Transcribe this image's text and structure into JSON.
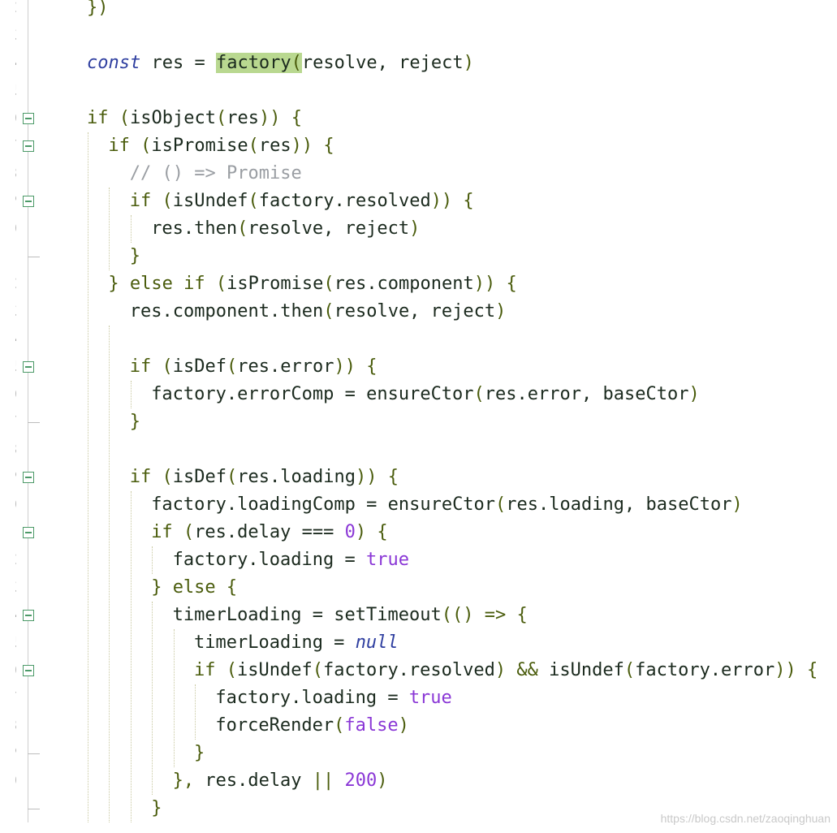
{
  "editor": {
    "line_numbers": [
      "2",
      "3",
      "4",
      "5",
      "6",
      "7",
      "8",
      "9",
      "0",
      "1",
      "2",
      "3",
      "4",
      "5",
      "6",
      "7",
      "8",
      "9",
      "0",
      "1",
      "2",
      "3",
      "4",
      "5",
      "6",
      "7",
      "8",
      "9",
      "0",
      "1"
    ],
    "lines": [
      {
        "tokens": [
          {
            "t": "})",
            "c": "punc"
          }
        ]
      },
      {
        "tokens": []
      },
      {
        "tokens": [
          {
            "t": "const",
            "c": "kw-const"
          },
          {
            "t": " res = ",
            "c": "plain"
          },
          {
            "t": "factory",
            "c": "fn hl"
          },
          {
            "t": "(",
            "c": "punc hl"
          },
          {
            "t": "resolve, reject",
            "c": "plain"
          },
          {
            "t": ")",
            "c": "punc"
          }
        ]
      },
      {
        "tokens": []
      },
      {
        "tokens": [
          {
            "t": "if",
            "c": "kw"
          },
          {
            "t": " (",
            "c": "punc"
          },
          {
            "t": "isObject",
            "c": "fn"
          },
          {
            "t": "(",
            "c": "punc"
          },
          {
            "t": "res",
            "c": "plain"
          },
          {
            "t": ")) {",
            "c": "punc"
          }
        ]
      },
      {
        "tokens": [
          {
            "t": "if",
            "c": "kw"
          },
          {
            "t": " (",
            "c": "punc"
          },
          {
            "t": "isPromise",
            "c": "fn"
          },
          {
            "t": "(",
            "c": "punc"
          },
          {
            "t": "res",
            "c": "plain"
          },
          {
            "t": ")) {",
            "c": "punc"
          }
        ]
      },
      {
        "tokens": [
          {
            "t": "// () => Promise",
            "c": "comment"
          }
        ]
      },
      {
        "tokens": [
          {
            "t": "if",
            "c": "kw"
          },
          {
            "t": " (",
            "c": "punc"
          },
          {
            "t": "isUndef",
            "c": "fn"
          },
          {
            "t": "(",
            "c": "punc"
          },
          {
            "t": "factory.resolved",
            "c": "plain"
          },
          {
            "t": ")) {",
            "c": "punc"
          }
        ]
      },
      {
        "tokens": [
          {
            "t": "res.then",
            "c": "plain"
          },
          {
            "t": "(",
            "c": "punc"
          },
          {
            "t": "resolve, reject",
            "c": "plain"
          },
          {
            "t": ")",
            "c": "punc"
          }
        ]
      },
      {
        "tokens": [
          {
            "t": "}",
            "c": "punc"
          }
        ]
      },
      {
        "tokens": [
          {
            "t": "} ",
            "c": "punc"
          },
          {
            "t": "else if",
            "c": "kw"
          },
          {
            "t": " (",
            "c": "punc"
          },
          {
            "t": "isPromise",
            "c": "fn"
          },
          {
            "t": "(",
            "c": "punc"
          },
          {
            "t": "res.component",
            "c": "plain"
          },
          {
            "t": ")) {",
            "c": "punc"
          }
        ]
      },
      {
        "tokens": [
          {
            "t": "res.component.then",
            "c": "plain"
          },
          {
            "t": "(",
            "c": "punc"
          },
          {
            "t": "resolve, reject",
            "c": "plain"
          },
          {
            "t": ")",
            "c": "punc"
          }
        ]
      },
      {
        "tokens": []
      },
      {
        "tokens": [
          {
            "t": "if",
            "c": "kw"
          },
          {
            "t": " (",
            "c": "punc"
          },
          {
            "t": "isDef",
            "c": "fn"
          },
          {
            "t": "(",
            "c": "punc"
          },
          {
            "t": "res.error",
            "c": "plain"
          },
          {
            "t": ")) {",
            "c": "punc"
          }
        ]
      },
      {
        "tokens": [
          {
            "t": "factory.errorComp = ",
            "c": "plain"
          },
          {
            "t": "ensureCtor",
            "c": "fn"
          },
          {
            "t": "(",
            "c": "punc"
          },
          {
            "t": "res.error, baseCtor",
            "c": "plain"
          },
          {
            "t": ")",
            "c": "punc"
          }
        ]
      },
      {
        "tokens": [
          {
            "t": "}",
            "c": "punc"
          }
        ]
      },
      {
        "tokens": []
      },
      {
        "tokens": [
          {
            "t": "if",
            "c": "kw"
          },
          {
            "t": " (",
            "c": "punc"
          },
          {
            "t": "isDef",
            "c": "fn"
          },
          {
            "t": "(",
            "c": "punc"
          },
          {
            "t": "res.loading",
            "c": "plain"
          },
          {
            "t": ")) {",
            "c": "punc"
          }
        ]
      },
      {
        "tokens": [
          {
            "t": "factory.loadingComp = ",
            "c": "plain"
          },
          {
            "t": "ensureCtor",
            "c": "fn"
          },
          {
            "t": "(",
            "c": "punc"
          },
          {
            "t": "res.loading, baseCtor",
            "c": "plain"
          },
          {
            "t": ")",
            "c": "punc"
          }
        ]
      },
      {
        "tokens": [
          {
            "t": "if",
            "c": "kw"
          },
          {
            "t": " (",
            "c": "punc"
          },
          {
            "t": "res.delay === ",
            "c": "plain"
          },
          {
            "t": "0",
            "c": "num"
          },
          {
            "t": ") {",
            "c": "punc"
          }
        ]
      },
      {
        "tokens": [
          {
            "t": "factory.loading = ",
            "c": "plain"
          },
          {
            "t": "true",
            "c": "bool"
          }
        ]
      },
      {
        "tokens": [
          {
            "t": "} ",
            "c": "punc"
          },
          {
            "t": "else",
            "c": "kw"
          },
          {
            "t": " {",
            "c": "punc"
          }
        ]
      },
      {
        "tokens": [
          {
            "t": "timerLoading = ",
            "c": "plain"
          },
          {
            "t": "setTimeout",
            "c": "fn"
          },
          {
            "t": "(() => {",
            "c": "punc"
          }
        ]
      },
      {
        "tokens": [
          {
            "t": "timerLoading = ",
            "c": "plain"
          },
          {
            "t": "null",
            "c": "nullv"
          }
        ]
      },
      {
        "tokens": [
          {
            "t": "if",
            "c": "kw"
          },
          {
            "t": " (",
            "c": "punc"
          },
          {
            "t": "isUndef",
            "c": "fn"
          },
          {
            "t": "(",
            "c": "punc"
          },
          {
            "t": "factory.resolved",
            "c": "plain"
          },
          {
            "t": ") && ",
            "c": "punc"
          },
          {
            "t": "isUndef",
            "c": "fn"
          },
          {
            "t": "(",
            "c": "punc"
          },
          {
            "t": "factory.error",
            "c": "plain"
          },
          {
            "t": ")) {",
            "c": "punc"
          }
        ]
      },
      {
        "tokens": [
          {
            "t": "factory.loading = ",
            "c": "plain"
          },
          {
            "t": "true",
            "c": "bool"
          }
        ]
      },
      {
        "tokens": [
          {
            "t": "forceRender",
            "c": "fn"
          },
          {
            "t": "(",
            "c": "punc"
          },
          {
            "t": "false",
            "c": "bool"
          },
          {
            "t": ")",
            "c": "punc"
          }
        ]
      },
      {
        "tokens": [
          {
            "t": "}",
            "c": "punc"
          }
        ]
      },
      {
        "tokens": [
          {
            "t": "}, ",
            "c": "punc"
          },
          {
            "t": "res.delay ",
            "c": "plain"
          },
          {
            "t": "|| ",
            "c": "punc"
          },
          {
            "t": "200",
            "c": "num"
          },
          {
            "t": ")",
            "c": "punc"
          }
        ]
      },
      {
        "tokens": [
          {
            "t": "}",
            "c": "punc"
          }
        ]
      }
    ]
  },
  "watermark": "https://blog.csdn.net/zaoqinghuan",
  "colors": {
    "keyword": "#4a5c0c",
    "const_keyword": "#2f3fa0",
    "identifier": "#1b2a1e",
    "comment": "#9a9ea3",
    "number_bool": "#8a37d6",
    "highlight": "#b9d890",
    "fold_marker": "#4c9a68"
  },
  "icons": [
    "fold-collapse-icon",
    "fold-end-marker"
  ]
}
